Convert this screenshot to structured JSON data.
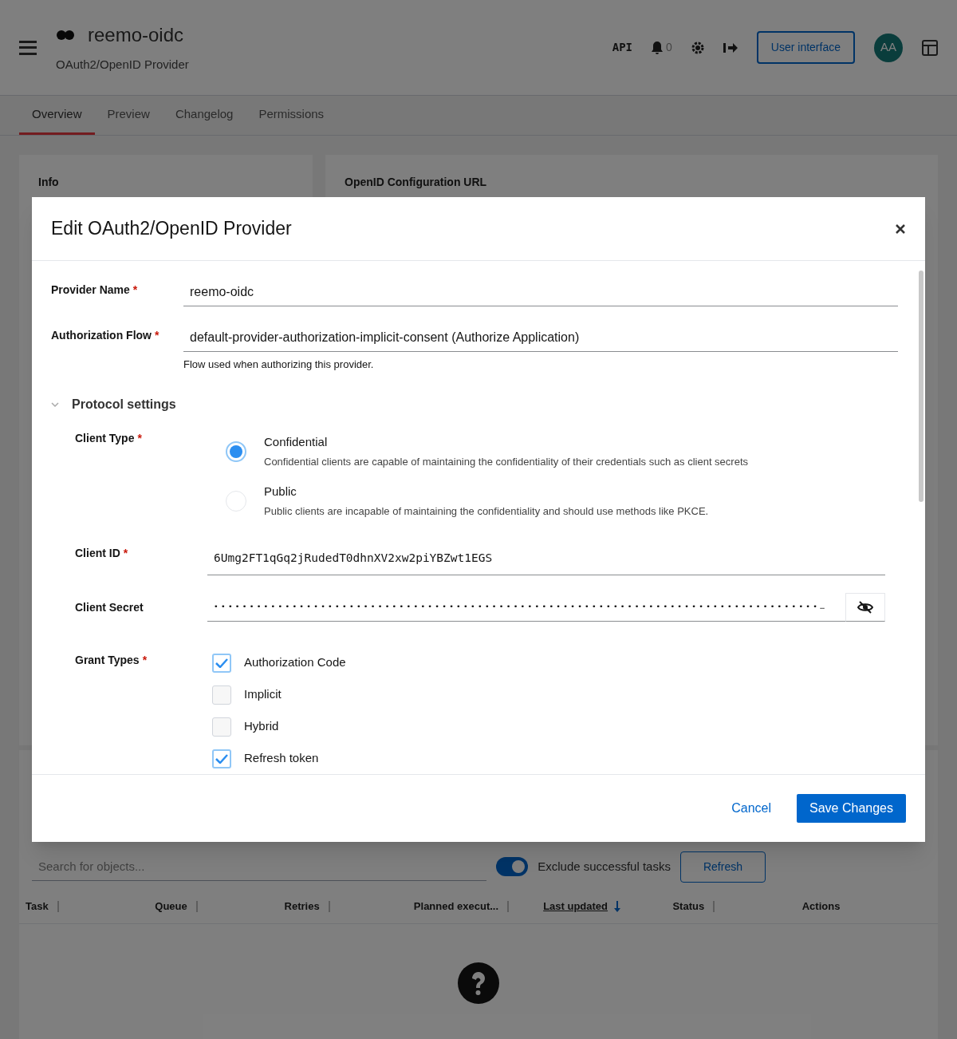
{
  "app_header": {
    "title": "reemo-oidc",
    "subtitle": "OAuth2/OpenID Provider",
    "api_label": "API",
    "notification_count": "0",
    "ui_button": "User interface",
    "avatar_initials": "AA"
  },
  "tabs": [
    {
      "label": "Overview",
      "selected": true
    },
    {
      "label": "Preview",
      "selected": false
    },
    {
      "label": "Changelog",
      "selected": false
    },
    {
      "label": "Permissions",
      "selected": false
    }
  ],
  "cards": [
    {
      "title": "Info"
    },
    {
      "title": "OpenID Configuration URL"
    }
  ],
  "tasks": {
    "search_placeholder": "Search for objects...",
    "exclude_toggle": {
      "label": "Exclude successful tasks",
      "on": true
    },
    "refresh_button": "Refresh",
    "columns": [
      {
        "label": "Task",
        "sorted": false
      },
      {
        "label": "Queue",
        "sorted": false
      },
      {
        "label": "Retries",
        "sorted": false
      },
      {
        "label": "Planned execut...",
        "sorted": false
      },
      {
        "label": "Last updated",
        "sorted": true
      },
      {
        "label": "Status",
        "sorted": false
      },
      {
        "label": "Actions"
      }
    ]
  },
  "modal": {
    "title": "Edit OAuth2/OpenID Provider",
    "fields": [
      {
        "label": "Provider Name",
        "required_mark": "*",
        "value": "reemo-oidc"
      },
      {
        "label": "Authorization Flow",
        "required_mark": "*",
        "value": "default-provider-authorization-implicit-consent (Authorize Application)",
        "helper": "Flow used when authorizing this provider."
      }
    ],
    "section": {
      "title": "Protocol settings",
      "expanded": true,
      "fields": [
        {
          "kind": "radio",
          "label": "Client Type",
          "required_mark": "*",
          "options": [
            {
              "label": "Confidential",
              "description": "Confidential clients are capable of maintaining the confidentiality of their credentials such as client secrets",
              "selected": true
            },
            {
              "label": "Public",
              "description": "Public clients are incapable of maintaining the confidentiality and should use methods like PKCE.",
              "selected": false
            }
          ]
        },
        {
          "kind": "mono",
          "label": "Client ID",
          "required_mark": "*",
          "value": "6Umg2FT1qGq2jRudedT0dhnXV2xw2piYBZwt1EGS"
        },
        {
          "kind": "secret",
          "label": "Client Secret",
          "value": "•••••••••••••••••••••••••••••••••••••••••••••••••••••••••••••••••••••••••••••••••••••…"
        },
        {
          "kind": "checkboxes",
          "label": "Grant Types",
          "required_mark": "*",
          "options": [
            {
              "label": "Authorization Code",
              "checked": true
            },
            {
              "label": "Implicit",
              "checked": false
            },
            {
              "label": "Hybrid",
              "checked": false
            },
            {
              "label": "Refresh token",
              "checked": true
            }
          ]
        }
      ]
    },
    "buttons": {
      "cancel": "Cancel",
      "save": "Save Changes"
    }
  }
}
